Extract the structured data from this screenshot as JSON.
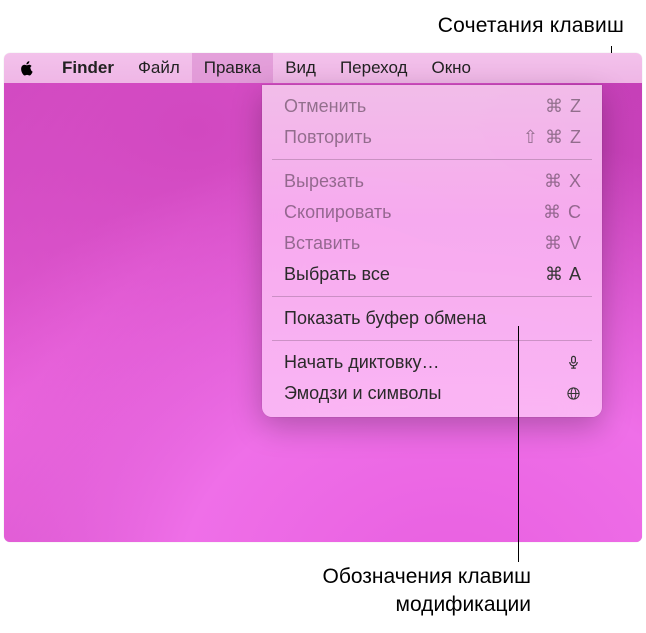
{
  "callouts": {
    "top": "Сочетания клавиш",
    "bottom_line1": "Обозначения клавиш",
    "bottom_line2": "модификации"
  },
  "menubar": {
    "app": "Finder",
    "items": [
      "Файл",
      "Правка",
      "Вид",
      "Переход",
      "Окно"
    ],
    "active_index": 1
  },
  "menu": {
    "groups": [
      [
        {
          "label": "Отменить",
          "shortcut": "⌘ Z",
          "disabled": true
        },
        {
          "label": "Повторить",
          "shortcut": "⇧ ⌘ Z",
          "disabled": true
        }
      ],
      [
        {
          "label": "Вырезать",
          "shortcut": "⌘ X",
          "disabled": true
        },
        {
          "label": "Скопировать",
          "shortcut": "⌘ C",
          "disabled": true
        },
        {
          "label": "Вставить",
          "shortcut": "⌘ V",
          "disabled": true
        },
        {
          "label": "Выбрать все",
          "shortcut": "⌘ A",
          "disabled": false
        }
      ],
      [
        {
          "label": "Показать буфер обмена",
          "shortcut": "",
          "disabled": false
        }
      ],
      [
        {
          "label": "Начать диктовку…",
          "shortcut_icon": "mic",
          "disabled": false
        },
        {
          "label": "Эмодзи и символы",
          "shortcut_icon": "globe",
          "disabled": false
        }
      ]
    ]
  }
}
